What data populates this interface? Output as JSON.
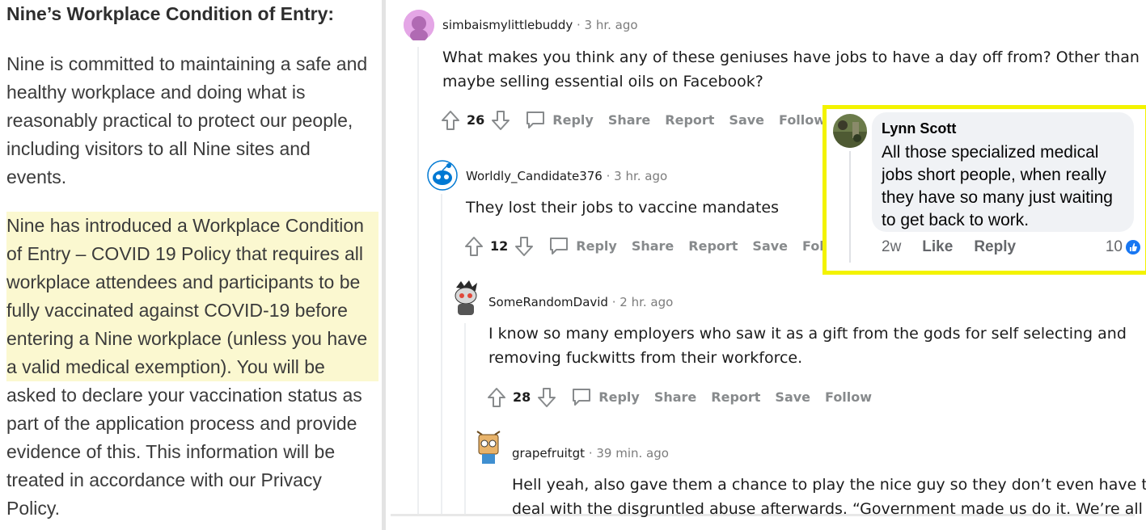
{
  "policy": {
    "heading": "Nine’s Workplace Condition of Entry:",
    "para1_lines": [
      "Nine is committed to maintaining a safe and",
      "healthy workplace and doing what is",
      "reasonably practical to protect our people,",
      "including visitors to all Nine sites and",
      "events."
    ],
    "para2_highlight_lines": [
      "Nine has introduced a Workplace Condition",
      "of Entry – COVID 19 Policy that requires all",
      "workplace attendees and participants to be",
      "fully vaccinated against COVID-19 before",
      "entering a Nine workplace (unless you have",
      "a valid medical exemption).  You will be"
    ],
    "para2_plain_lines": [
      "asked to declare your vaccination status as",
      "part of the application process and provide",
      "evidence of this. This information will be",
      "treated in accordance with our Privacy",
      "Policy."
    ]
  },
  "comments": [
    {
      "username": "simbaismylittlebuddy",
      "time": " · 3 hr. ago",
      "body_lines": [
        "What makes you think any of these geniuses have jobs to have a day off from? Other than",
        "maybe selling essential oils on Facebook?"
      ],
      "votes": "26"
    },
    {
      "username": "Worldly_Candidate376",
      "time": " · 3 hr. ago",
      "body_lines": [
        "They lost their jobs to vaccine mandates"
      ],
      "votes": "12"
    },
    {
      "username": "SomeRandomDavid",
      "time": " · 2 hr. ago",
      "body_lines": [
        "I know so many employers who saw it as a gift from the gods for self selecting and",
        "removing fuckwitts from their workforce."
      ],
      "votes": "28"
    },
    {
      "username": "grapefruitgt",
      "time": " · 39 min. ago",
      "body_lines": [
        "Hell yeah, also gave them a chance to play the nice guy so they don’t even have to",
        "deal with the disgruntled abuse afterwards. “Government made us do it. We’re all so"
      ]
    }
  ],
  "action_labels": {
    "reply": "Reply",
    "share": "Share",
    "report": "Report",
    "save": "Save",
    "follow": "Follow"
  },
  "facebook": {
    "name": "Lynn Scott",
    "text_lines": [
      "All those specialized medical",
      "jobs short people, when really",
      "they have so many just waiting",
      "to get back to work."
    ],
    "time": "2w",
    "like": "Like",
    "reply": "Reply",
    "reaction_count": "10",
    "highlight_color": "#f3f300"
  },
  "colors": {
    "highlight": "#fbf8d0",
    "action_gray": "#878a8c"
  }
}
